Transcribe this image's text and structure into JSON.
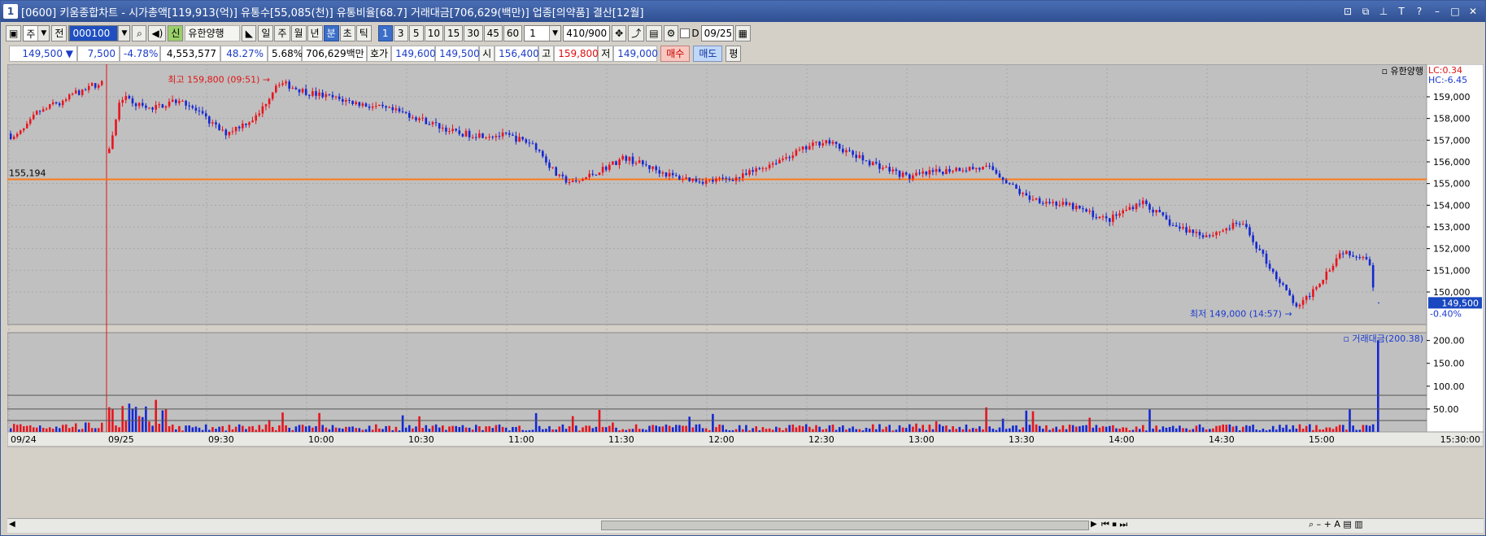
{
  "window": {
    "id_badge": "1",
    "title": "[0600] 키움종합차트 - 시가총액[119,913(억)]  유통수[55,085(천)]  유통비율[68.7]  거래대금[706,629(백만)]  업종[의약품]  결산[12월]"
  },
  "toolbar": {
    "type_label": "주",
    "prev_label": "전",
    "stock_code": "000100",
    "stock_name": "유한양행",
    "sin_label": "신",
    "period_buttons": [
      "일",
      "주",
      "월",
      "년",
      "분",
      "초",
      "틱"
    ],
    "minute_buttons": [
      "1",
      "3",
      "5",
      "10",
      "15",
      "30",
      "45",
      "60"
    ],
    "interval_value": "1",
    "count_value": "410",
    "count_total": "/900",
    "d_label": "D",
    "date_value": "09/25"
  },
  "quote": {
    "price": "149,500",
    "change": "7,500",
    "change_pct": "-4.78%",
    "volume": "4,553,577",
    "volume_ratio": "48.27%",
    "turnover": "5.68%",
    "amount": "706,629백만",
    "hoga_label": "호가",
    "ask": "149,600",
    "bid": "149,500",
    "open_label": "시",
    "open": "156,400",
    "high_label": "고",
    "high": "159,800",
    "low_label": "저",
    "low": "149,000",
    "buy_label": "매수",
    "sell_label": "매도",
    "avg_label": "평"
  },
  "colors": {
    "up": "#e8141e",
    "down": "#1428d2",
    "bg_price": "#c0c0c0",
    "ma_line": "#ff7a1a",
    "label_blue": "#1a3ad0",
    "label_red": "#e01414"
  },
  "chart_data": {
    "type": "candlestick",
    "title": "유한양행",
    "lc_label": "LC:0.34",
    "hc_label": "HC:-6.45",
    "y_ticks": [
      "159,000",
      "158,000",
      "157,000",
      "156,000",
      "155,000",
      "154,000",
      "153,000",
      "152,000",
      "151,000",
      "150,000"
    ],
    "ylim": [
      148500,
      160500
    ],
    "ref_line_label": "155,194",
    "ref_line_value": 155194,
    "current_price": "149,500",
    "current_change": "-0.40%",
    "high_annotation": "최고 159,800 (09:51)",
    "low_annotation": "최저 149,000 (14:57)",
    "high_value": 159800,
    "low_value": 149000,
    "session_open": 156400,
    "session_close": 149500,
    "x_ticks": [
      "09/24",
      "09/25",
      "09:30",
      "10:00",
      "10:30",
      "11:00",
      "11:30",
      "12:00",
      "12:30",
      "13:00",
      "13:30",
      "14:00",
      "14:30",
      "15:00"
    ],
    "x_axis_end": "15:30:00",
    "price_anchors": [
      [
        "09:00",
        156400
      ],
      [
        "09:04",
        159000
      ],
      [
        "09:12",
        158400
      ],
      [
        "09:22",
        158900
      ],
      [
        "09:35",
        157300
      ],
      [
        "09:45",
        158100
      ],
      [
        "09:51",
        159700
      ],
      [
        "10:00",
        159200
      ],
      [
        "10:15",
        158700
      ],
      [
        "10:30",
        158200
      ],
      [
        "10:45",
        157300
      ],
      [
        "11:00",
        157200
      ],
      [
        "11:08",
        156800
      ],
      [
        "11:15",
        155300
      ],
      [
        "11:20",
        155000
      ],
      [
        "11:35",
        156200
      ],
      [
        "11:50",
        155300
      ],
      [
        "12:00",
        155100
      ],
      [
        "12:10",
        155300
      ],
      [
        "12:20",
        156000
      ],
      [
        "12:35",
        157000
      ],
      [
        "12:45",
        156200
      ],
      [
        "13:00",
        155300
      ],
      [
        "13:15",
        155700
      ],
      [
        "13:25",
        155700
      ],
      [
        "13:35",
        154400
      ],
      [
        "13:50",
        153900
      ],
      [
        "14:00",
        153300
      ],
      [
        "14:10",
        154200
      ],
      [
        "14:20",
        153000
      ],
      [
        "14:30",
        152600
      ],
      [
        "14:40",
        153200
      ],
      [
        "14:50",
        150800
      ],
      [
        "14:57",
        149200
      ],
      [
        "15:05",
        150800
      ],
      [
        "15:10",
        151900
      ],
      [
        "15:18",
        151600
      ],
      [
        "15:20",
        149800
      ]
    ],
    "volume_panel": {
      "label": "거래대금(200.38)",
      "y_ticks": [
        "200.00",
        "150.00",
        "100.00",
        "50.00"
      ],
      "ylim": [
        0,
        210
      ],
      "hlines": [
        25,
        50,
        80
      ],
      "last_bar": 200.38
    }
  },
  "bottom": {
    "scroll_left": "◀",
    "scroll_right": "▶"
  }
}
